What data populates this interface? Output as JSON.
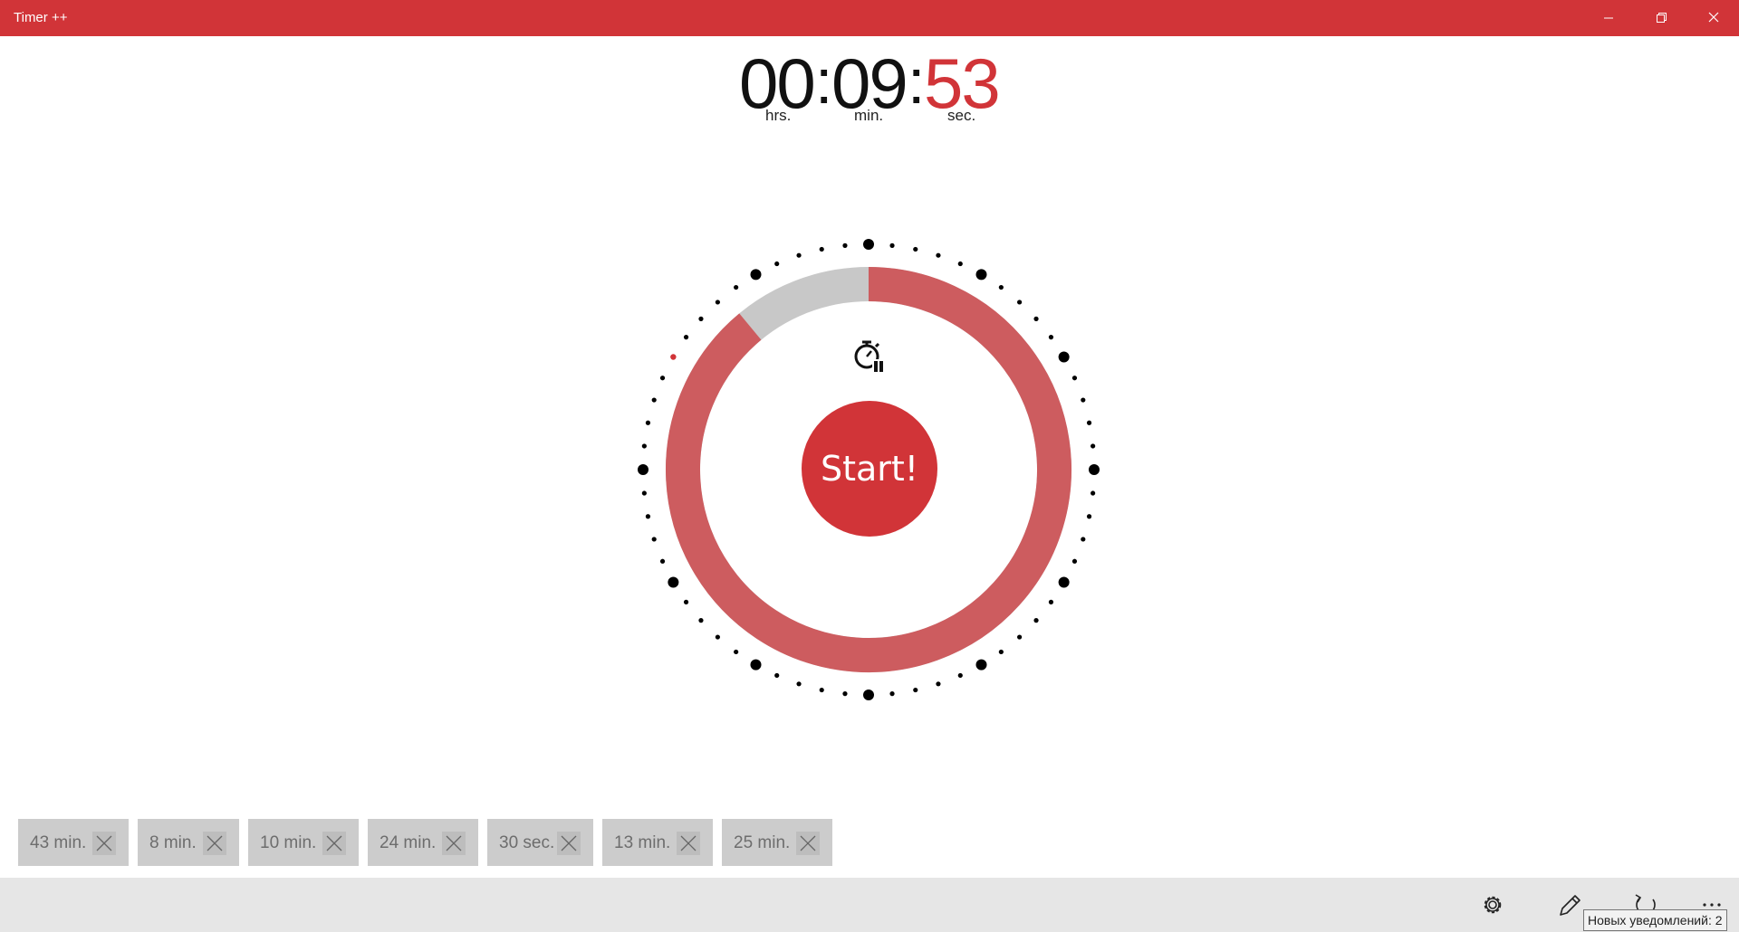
{
  "app": {
    "title": "Timer ++",
    "accent_color": "#d13438",
    "window_controls": [
      "minimize-icon",
      "restore-icon",
      "close-icon"
    ]
  },
  "timer": {
    "hours": "00",
    "minutes": "09",
    "seconds": "53",
    "separator": ":",
    "hours_unit": "hrs.",
    "minutes_unit": "min.",
    "seconds_unit": "sec.",
    "remaining_fraction": 0.89,
    "progress_color": "#cd5c5f",
    "elapsed_color": "#c8c8c8"
  },
  "controls": {
    "start_label": "Start!",
    "stopwatch_icon": "stopwatch-pause-icon"
  },
  "presets": [
    {
      "label": "43 min."
    },
    {
      "label": "8 min."
    },
    {
      "label": "10 min."
    },
    {
      "label": "24 min."
    },
    {
      "label": "30 sec."
    },
    {
      "label": "13 min."
    },
    {
      "label": "25 min."
    }
  ],
  "bottom_bar": {
    "icons": [
      "settings-icon",
      "edit-icon",
      "reset-icon",
      "more-icon"
    ],
    "tooltip": "Новых уведомлений: 2"
  }
}
